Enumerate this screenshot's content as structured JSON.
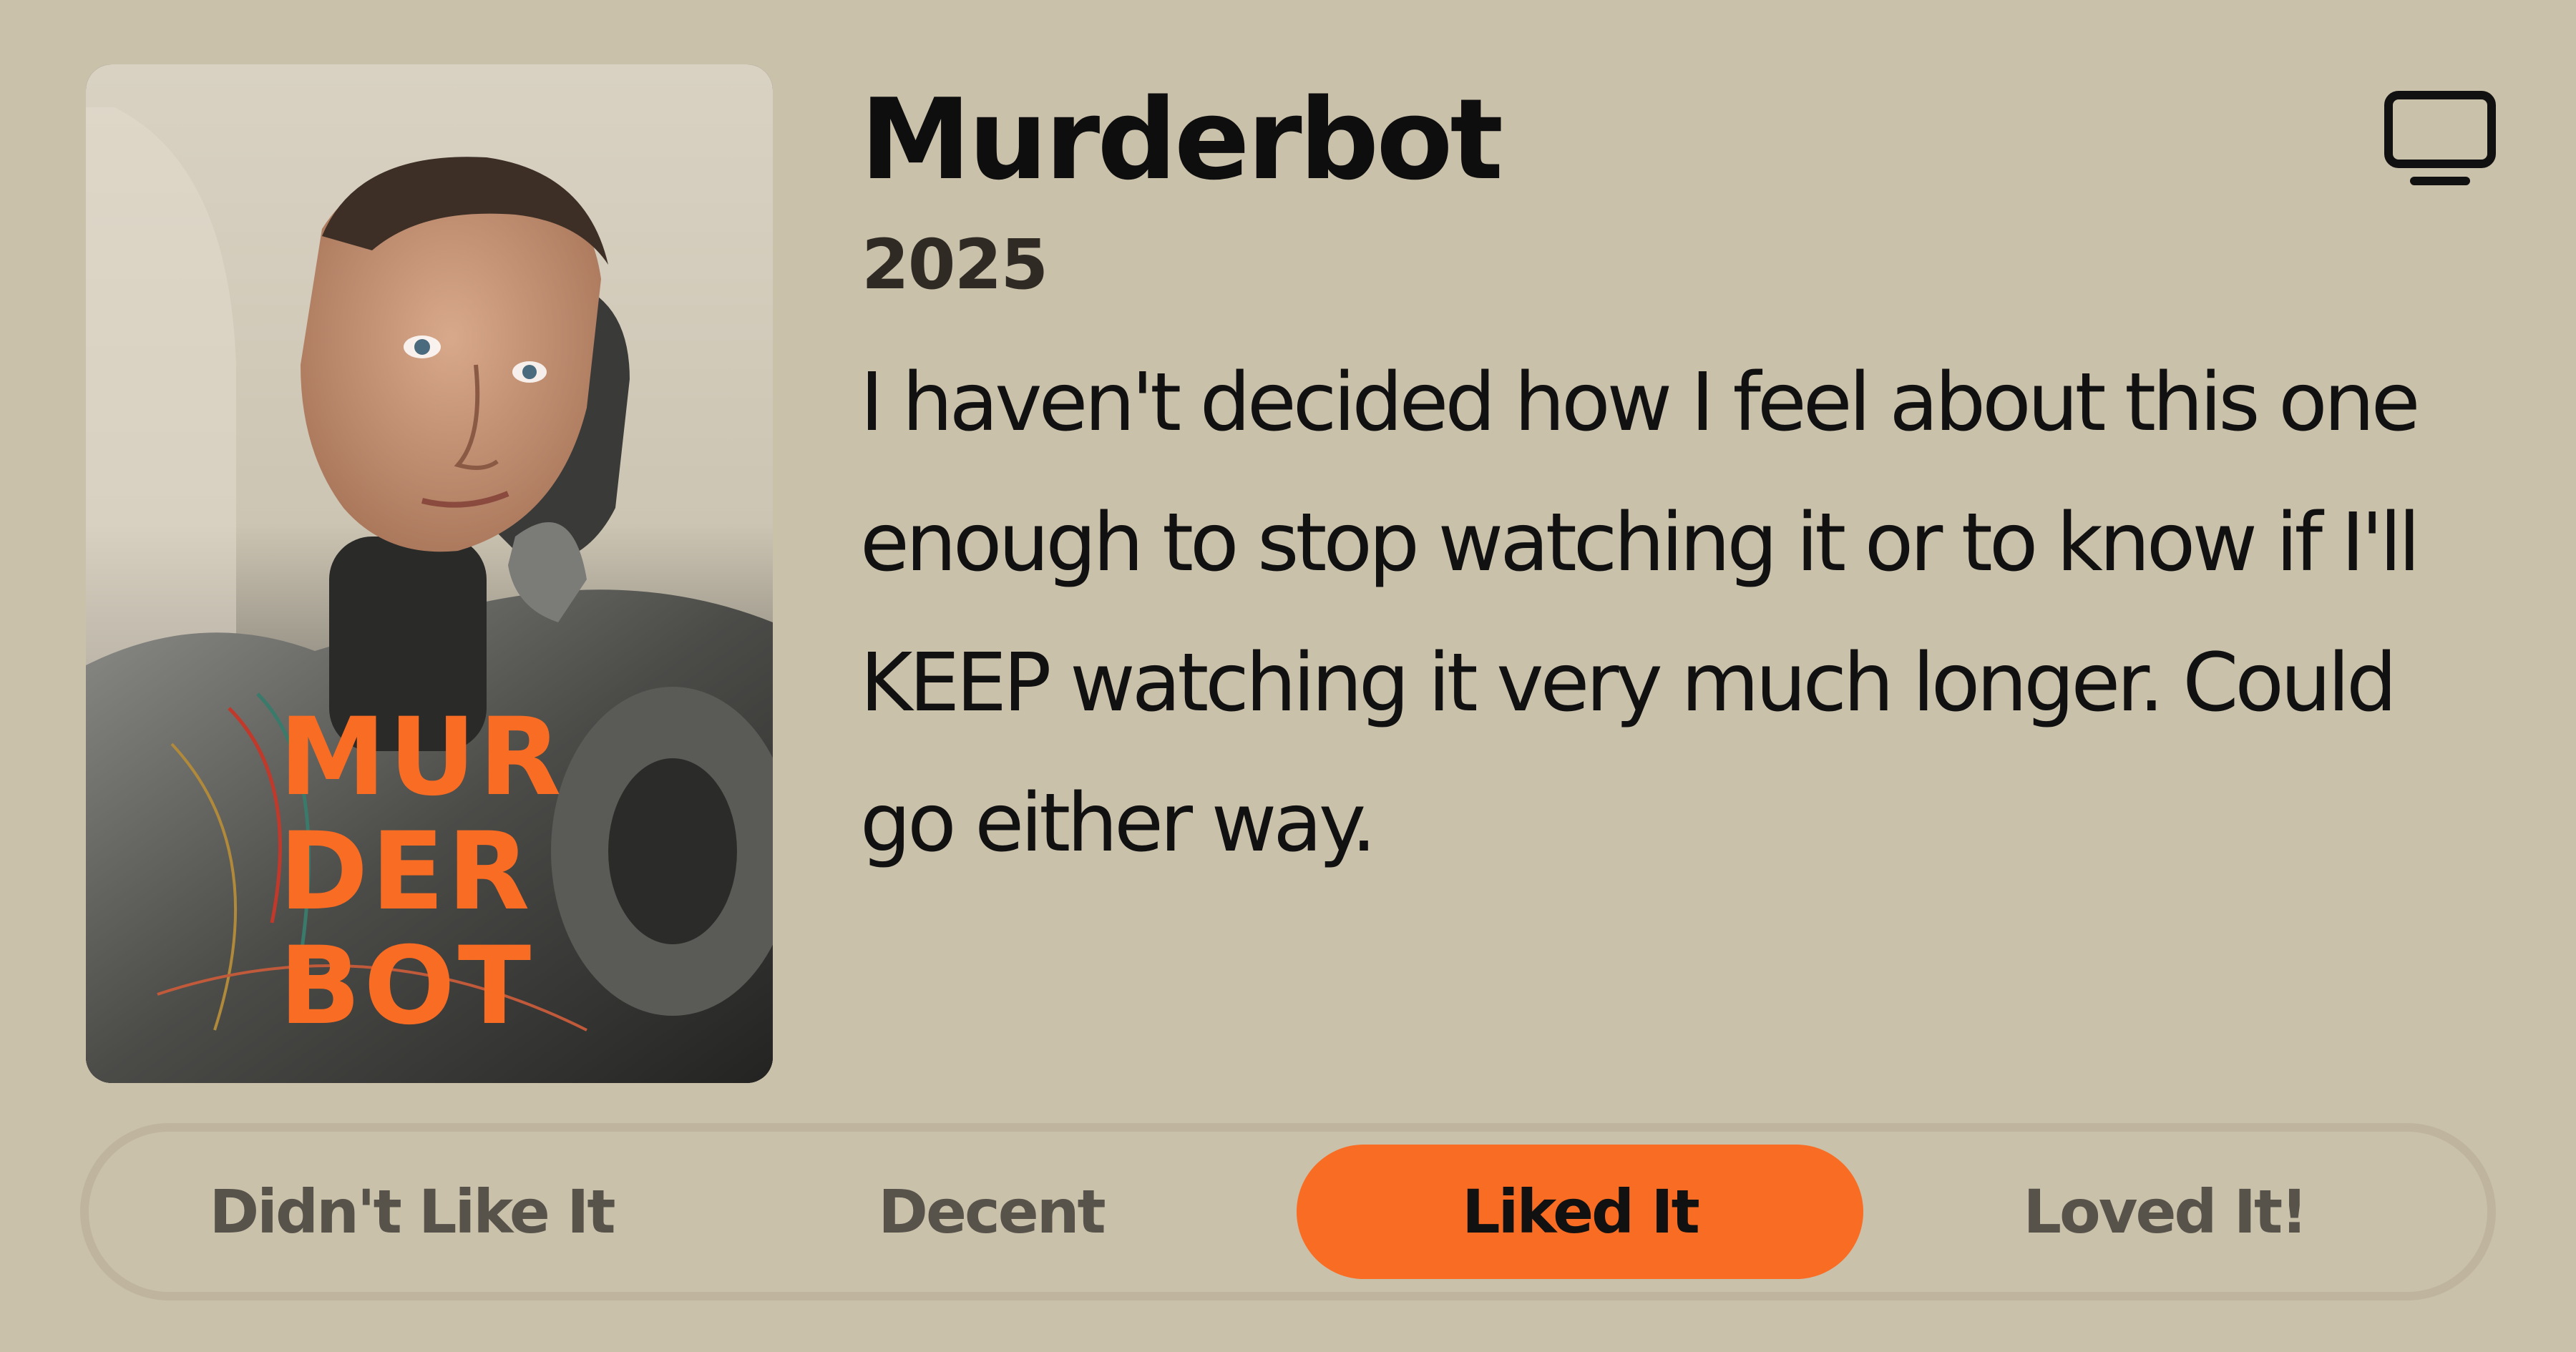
{
  "show": {
    "title": "Murderbot",
    "year": "2025",
    "review": "I haven't decided how I feel about this one enough to stop watching it or to know if I'll KEEP watching it very much longer. Could go either way.",
    "media_type_icon": "tv-icon"
  },
  "poster": {
    "logo_text": "MURDERBOT",
    "logo_color": "#f96c23"
  },
  "rating": {
    "options": [
      "Didn't Like It",
      "Decent",
      "Liked It",
      "Loved It!"
    ],
    "selected": "Liked It"
  },
  "colors": {
    "background": "#cac1ab",
    "accent": "#f96c23",
    "rating_border": "#bfb59e"
  }
}
